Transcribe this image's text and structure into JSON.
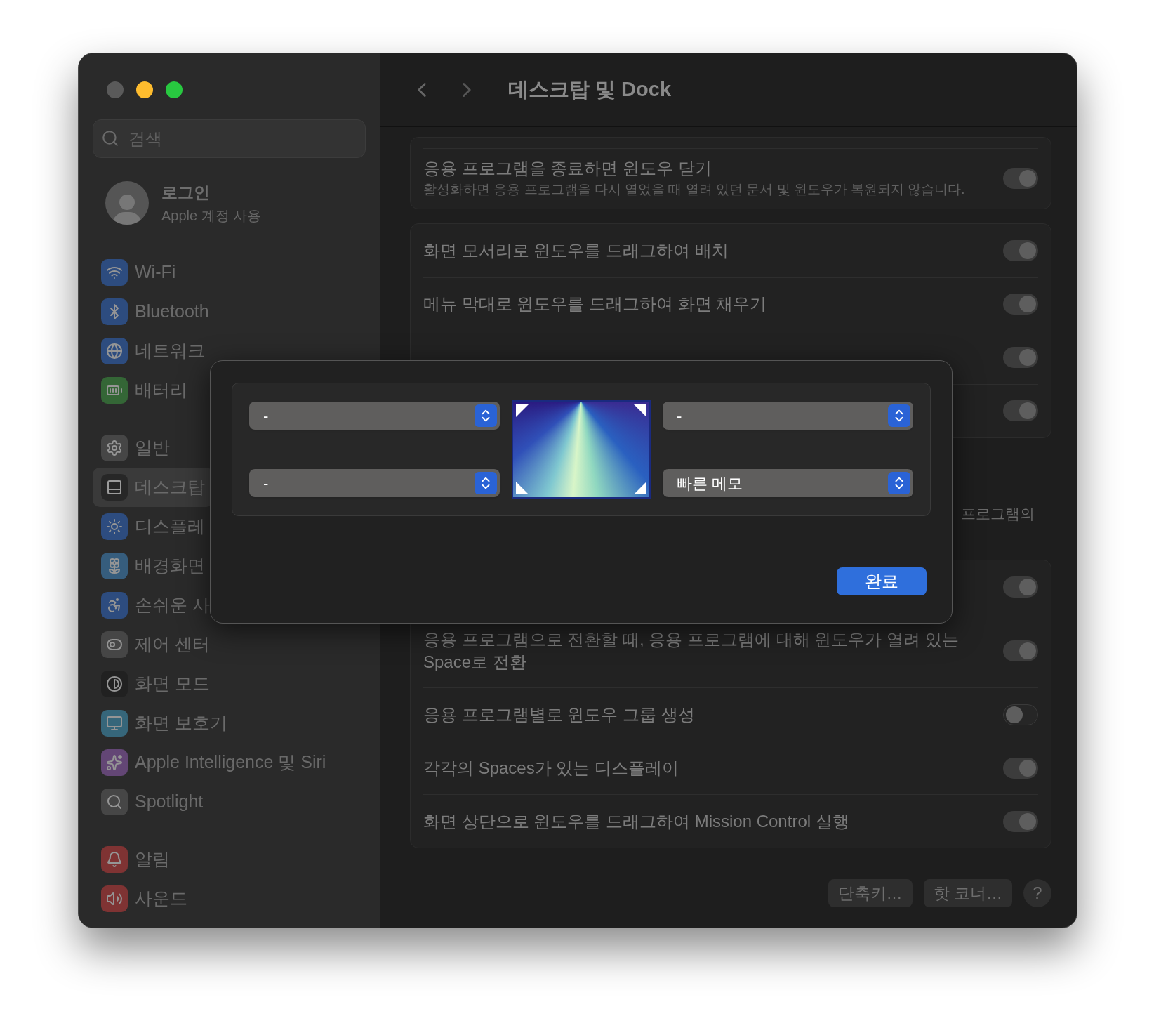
{
  "window": {
    "title": "데스크탑 및 Dock",
    "close_disabled": true
  },
  "search": {
    "placeholder": "검색"
  },
  "account": {
    "name": "로그인",
    "subtitle": "Apple 계정 사용"
  },
  "sidebar": {
    "groups": [
      [
        {
          "label": "Wi-Fi",
          "selected": false
        },
        {
          "label": "Bluetooth",
          "selected": false
        },
        {
          "label": "네트워크",
          "selected": false
        },
        {
          "label": "배터리",
          "selected": false
        }
      ],
      [
        {
          "label": "일반",
          "selected": false
        },
        {
          "label": "데스크탑",
          "selected": true
        },
        {
          "label": "디스플레",
          "selected": false
        },
        {
          "label": "배경화면",
          "selected": false
        },
        {
          "label": "손쉬운 사",
          "selected": false
        },
        {
          "label": "제어 센터",
          "selected": false
        },
        {
          "label": "화면 모드",
          "selected": false
        },
        {
          "label": "화면 보호기",
          "selected": false
        },
        {
          "label": "Apple Intelligence 및 Siri",
          "selected": false
        },
        {
          "label": "Spotlight",
          "selected": false
        }
      ],
      [
        {
          "label": "알림",
          "selected": false
        },
        {
          "label": "사운드",
          "selected": false
        }
      ]
    ]
  },
  "main": {
    "groups": [
      {
        "rows": [
          {
            "label": "응용 프로그램을 종료하면 윈도우 닫기",
            "description": "활성화하면 응용 프로그램을 다시 열었을 때 열려 있던 문서 및 윈도우가 복원되지 않습니다.",
            "on": true
          }
        ]
      },
      {
        "rows": [
          {
            "label": "화면 모서리로 윈도우를 드래그하여 배치",
            "on": true
          },
          {
            "label": "메뉴 막대로 윈도우를 드래그하여 화면 채우기",
            "on": true
          },
          {
            "on": true
          },
          {
            "on": true
          }
        ]
      },
      {
        "note": "프로그램의",
        "rows": [
          {
            "on": true
          },
          {
            "label": "응용 프로그램으로 전환할 때, 응용 프로그램에 대해 윈도우가 열려 있는 Space로 전환",
            "on": true
          },
          {
            "label": "응용 프로그램별로 윈도우 그룹 생성",
            "on": false
          },
          {
            "label": "각각의 Spaces가 있는 디스플레이",
            "on": true
          },
          {
            "label": "화면 상단으로 윈도우를 드래그하여 Mission Control 실행",
            "on": true
          }
        ]
      }
    ],
    "footer_buttons": [
      "단축키…",
      "핫 코너…"
    ],
    "help": "?"
  },
  "sheet": {
    "corners": [
      {
        "value": "-"
      },
      {
        "value": "-"
      },
      {
        "value": "-"
      },
      {
        "value": "빠른 메모"
      }
    ],
    "done": "완료"
  }
}
